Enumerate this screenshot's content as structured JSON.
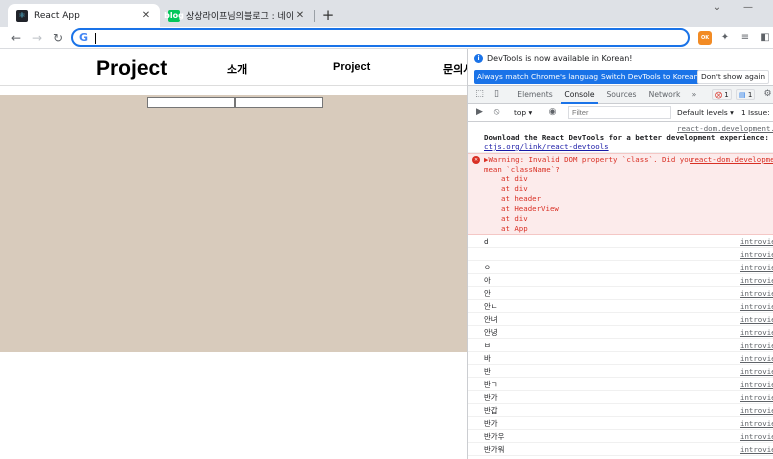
{
  "browser": {
    "tabs": [
      {
        "title": "React App",
        "favicon": "react-icon",
        "active": true
      },
      {
        "title": "상상라이프님의블로그 : 네이버 ...",
        "favicon": "naver-blog-icon",
        "active": false
      }
    ],
    "new_tab_symbol": "+",
    "address_value": ""
  },
  "app": {
    "logo": "Project",
    "nav": [
      "소개",
      "Project",
      "문의사"
    ],
    "background_color": "#d8cbbc",
    "inputs": [
      {
        "value": ""
      },
      {
        "value": ""
      }
    ]
  },
  "devtools": {
    "infobar": {
      "message": "DevTools is now available in Korean!",
      "btn_match": "Always match Chrome's language",
      "btn_switch": "Switch DevTools to Korean",
      "btn_dismiss": "Don't show again"
    },
    "tabs": [
      "Elements",
      "Console",
      "Sources",
      "Network"
    ],
    "active_tab": "Console",
    "more_tabs": "»",
    "error_count": "1",
    "message_count": "1",
    "console_bar": {
      "context": "top",
      "filter_placeholder": "Filter",
      "levels": "Default levels",
      "issues": "1 Issue:"
    },
    "info_message": {
      "source": "react-dom.development.js",
      "line1": "Download the React DevTools for a better development experience: https://reactjs.org/link/react-devtools",
      "line1_visible": "Download the React DevTools for a better development experience: http",
      "line2_visible": "ctjs.org/link/react-devtools"
    },
    "error_message": {
      "line1": "▶Warning: Invalid DOM property `class`. Did you",
      "line2": "mean `className`?",
      "source": "react-dom.developmen",
      "stack": [
        "at div",
        "at div",
        "at header",
        "at HeaderView",
        "at div",
        "at App"
      ]
    },
    "log_rows": [
      {
        "text": "d",
        "source": "introvie"
      },
      {
        "text": "",
        "source": "introvie"
      },
      {
        "text": "ㅇ",
        "source": "introvie"
      },
      {
        "text": "아",
        "source": "introvie"
      },
      {
        "text": "안",
        "source": "introvie"
      },
      {
        "text": "안ㄴ",
        "source": "introvie"
      },
      {
        "text": "안녀",
        "source": "introvie"
      },
      {
        "text": "안녕",
        "source": "introvie"
      },
      {
        "text": "ㅂ",
        "source": "introvie"
      },
      {
        "text": "바",
        "source": "introvie"
      },
      {
        "text": "반",
        "source": "introvie"
      },
      {
        "text": "반ㄱ",
        "source": "introvie"
      },
      {
        "text": "반가",
        "source": "introvie"
      },
      {
        "text": "반갑",
        "source": "introvie"
      },
      {
        "text": "반가",
        "source": "introvie"
      },
      {
        "text": "반가우",
        "source": "introvie"
      },
      {
        "text": "반가워",
        "source": "introvie"
      }
    ]
  }
}
